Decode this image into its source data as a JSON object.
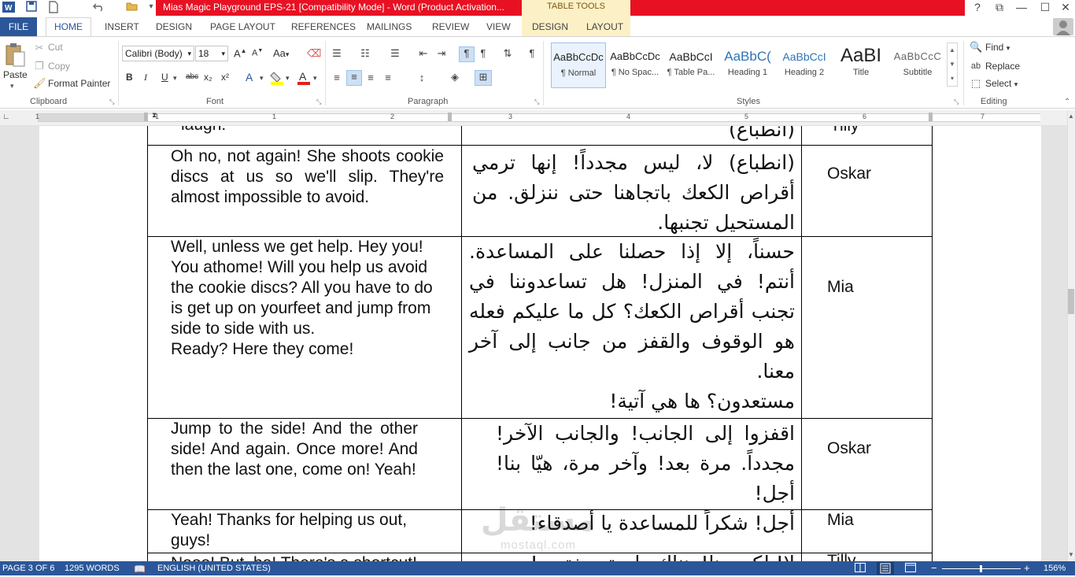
{
  "titlebar": {
    "title": "Mias Magic Playground EPS-21 [Compatibility Mode] -  Word (Product Activation...",
    "contextual": "TABLE TOOLS",
    "help": "?",
    "restore": "⧉",
    "minimize": "—",
    "maximize": "☐"
  },
  "tabs": [
    "FILE",
    "HOME",
    "INSERT",
    "DESIGN",
    "PAGE LAYOUT",
    "REFERENCES",
    "MAILINGS",
    "REVIEW",
    "VIEW",
    "DESIGN",
    "LAYOUT"
  ],
  "clipboard": {
    "paste": "Paste",
    "cut": "Cut",
    "copy": "Copy",
    "format_painter": "Format Painter",
    "label": "Clipboard"
  },
  "font": {
    "name": "Calibri (Body)",
    "size": "18",
    "label": "Font",
    "bold": "B",
    "italic": "I",
    "underline": "U",
    "strike": "abc",
    "sub": "x₂",
    "sup": "x²",
    "case": "Aa"
  },
  "paragraph": {
    "label": "Paragraph"
  },
  "styles": {
    "label": "Styles",
    "items": [
      {
        "preview": "AaBbCcDc",
        "name": "¶ Normal"
      },
      {
        "preview": "AaBbCcDc",
        "name": "¶ No Spac..."
      },
      {
        "preview": "AaBbCcI",
        "name": "¶ Table Pa..."
      },
      {
        "preview": "AaBbC(",
        "name": "Heading 1"
      },
      {
        "preview": "AaBbCcI",
        "name": "Heading 2"
      },
      {
        "preview": "AaBI",
        "name": "Title"
      },
      {
        "preview": "AaBbCcC",
        "name": "Subtitle"
      }
    ]
  },
  "editing": {
    "find": "Find",
    "replace": "Replace",
    "select": "Select",
    "label": "Editing"
  },
  "ruler": [
    "1",
    "1",
    "2",
    "3",
    "4",
    "5",
    "6",
    "7"
  ],
  "table": {
    "partial_top": {
      "en": "laugh.",
      "ar": "(انطباع)",
      "speaker": "Tilly"
    },
    "rows": [
      {
        "en": "Oh no, not again! She shoots cookie discs at us so we'll slip. They're almost impossible to avoid.",
        "ar": "(انطباع) لا، ليس مجدداً! إنها ترمي أقراص الكعك باتجاهنا حتى ننزلق. من المستحيل تجنبها.",
        "speaker": "Oskar"
      },
      {
        "en": "Well, unless we get help. Hey you! You athome! Will you help us avoid the cookie discs? All you have to do is get up on yourfeet and jump from side to side with us.\nReady? Here they come!",
        "ar": "حسناً، إلا إذا حصلنا على المساعدة. أنتم! في المنزل! هل تساعدوننا في تجنب أقراص الكعك؟ كل ما عليكم فعله هو الوقوف والقفز من جانب إلى آخر معنا.\nمستعدون؟ ها هي آتية!",
        "speaker": "Mia"
      },
      {
        "en": "Jump to the side! And the other side! And again. Once more! And then the last one, come on! Yeah!",
        "ar": "اقفزوا إلى الجانب! والجانب الآخر! مجدداً. مرة بعد! وآخر مرة، هيّا بنا! أجل!",
        "speaker": "Oskar"
      },
      {
        "en": "Yeah! Thanks for helping us out, guys!",
        "ar": "أجل! شكراً للمساعدة يا أصدقاء!",
        "speaker": "Mia"
      }
    ],
    "partial_bottom": {
      "en": "Nooo! But, ha! There's a shortcut!",
      "ar": "لا! لكن، ها! هناك طريق مختصر!",
      "speaker": "Tilly"
    }
  },
  "watermark": {
    "line1": "مستقل",
    "line2": "mostaql.com"
  },
  "status": {
    "page": "PAGE 3 OF 6",
    "words": "1295 WORDS",
    "language": "ENGLISH (UNITED STATES)",
    "zoom": "156%",
    "minus": "−",
    "plus": "+"
  }
}
